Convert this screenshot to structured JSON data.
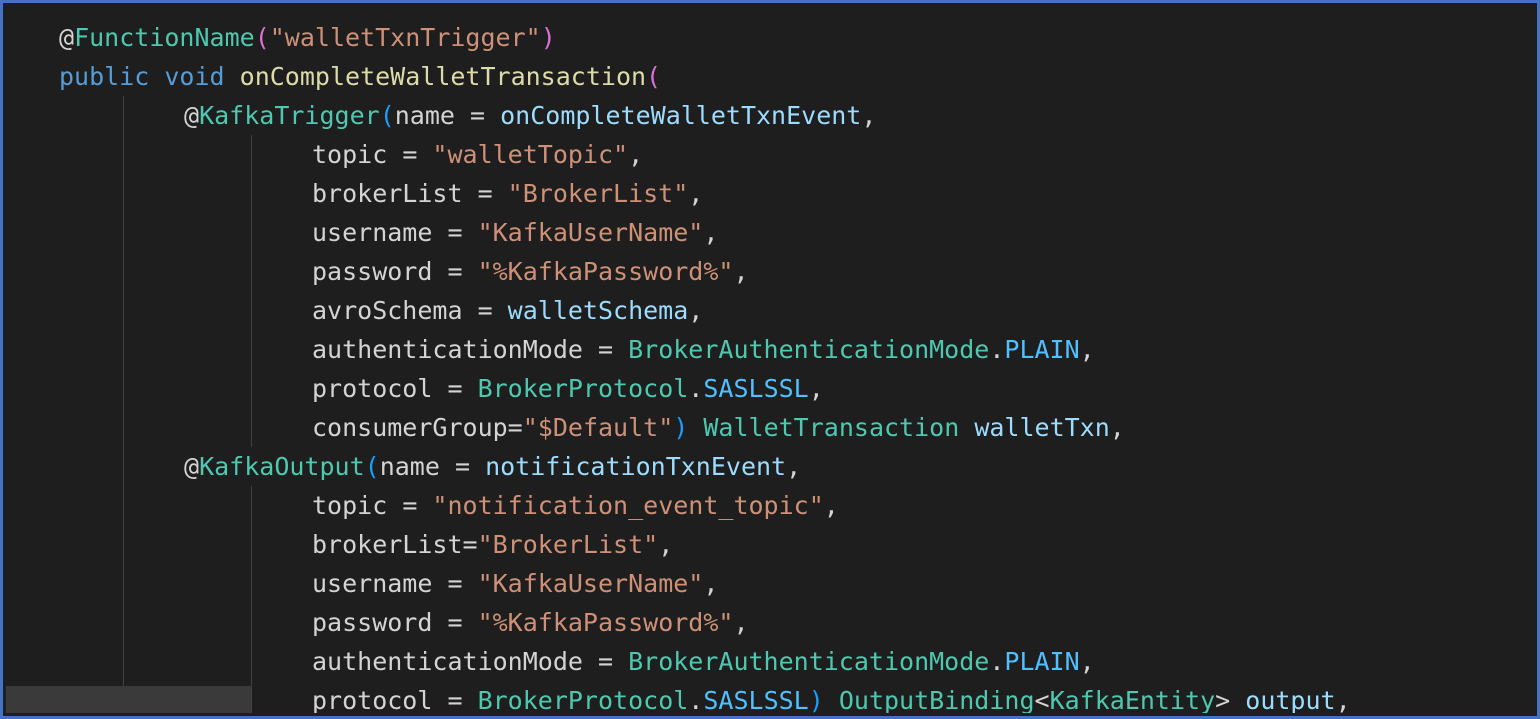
{
  "colors": {
    "frame_border": "#4472c4",
    "background": "#1e1e1e",
    "keyword": "#569cd6",
    "type": "#4ec9b0",
    "string": "#ce9178",
    "variable": "#9cdcfe",
    "function": "#dcdcaa",
    "plain": "#d4d4d4",
    "bracket_level1": "#da70d6",
    "bracket_level2": "#179fff",
    "constant": "#4fc1ff"
  },
  "code": {
    "l1": {
      "at": "@",
      "ann": "FunctionName",
      "open": "(",
      "str": "\"walletTxnTrigger\"",
      "close": ")"
    },
    "l2": {
      "kw1": "public",
      "kw2": "void",
      "fn": "onCompleteWalletTransaction",
      "open": "("
    },
    "l3": {
      "at": "@",
      "ann": "KafkaTrigger",
      "open": "(",
      "name": "name",
      "eq": " = ",
      "val": "onCompleteWalletTxnEvent",
      "comma": ","
    },
    "l4": {
      "name": "topic",
      "eq": " = ",
      "str": "\"walletTopic\"",
      "comma": ","
    },
    "l5": {
      "name": "brokerList",
      "eq": " = ",
      "str": "\"BrokerList\"",
      "comma": ","
    },
    "l6": {
      "name": "username",
      "eq": " = ",
      "str": "\"KafkaUserName\"",
      "comma": ","
    },
    "l7": {
      "name": "password",
      "eq": " = ",
      "str": "\"%KafkaPassword%\"",
      "comma": ","
    },
    "l8": {
      "name": "avroSchema",
      "eq": " = ",
      "val": "walletSchema",
      "comma": ","
    },
    "l9": {
      "name": "authenticationMode",
      "eq": " = ",
      "type": "BrokerAuthenticationMode",
      "dot": ".",
      "const": "PLAIN",
      "comma": ","
    },
    "l10": {
      "name": "protocol",
      "eq": " = ",
      "type": "BrokerProtocol",
      "dot": ".",
      "const": "SASLSSL",
      "comma": ","
    },
    "l11": {
      "name": "consumerGroup",
      "eq": "=",
      "str": "\"$Default\"",
      "close": ")",
      "type": "WalletTransaction",
      "var": "walletTxn",
      "comma": ","
    },
    "l12": {
      "at": "@",
      "ann": "KafkaOutput",
      "open": "(",
      "name": "name",
      "eq": " = ",
      "val": "notificationTxnEvent",
      "comma": ","
    },
    "l13": {
      "name": "topic",
      "eq": " = ",
      "str": "\"notification_event_topic\"",
      "comma": ","
    },
    "l14": {
      "name": "brokerList",
      "eq": "=",
      "str": "\"BrokerList\"",
      "comma": ","
    },
    "l15": {
      "name": "username",
      "eq": " = ",
      "str": "\"KafkaUserName\"",
      "comma": ","
    },
    "l16": {
      "name": "password",
      "eq": " = ",
      "str": "\"%KafkaPassword%\"",
      "comma": ","
    },
    "l17": {
      "name": "authenticationMode",
      "eq": " = ",
      "type": "BrokerAuthenticationMode",
      "dot": ".",
      "const": "PLAIN",
      "comma": ","
    },
    "l18": {
      "name": "protocol",
      "eq": " = ",
      "type": "BrokerProtocol",
      "dot": ".",
      "const": "SASLSSL",
      "close": ")",
      "type2": "OutputBinding",
      "lt": "<",
      "type3": "KafkaEntity",
      "gt": ">",
      "var": "output",
      "comma": ","
    }
  }
}
